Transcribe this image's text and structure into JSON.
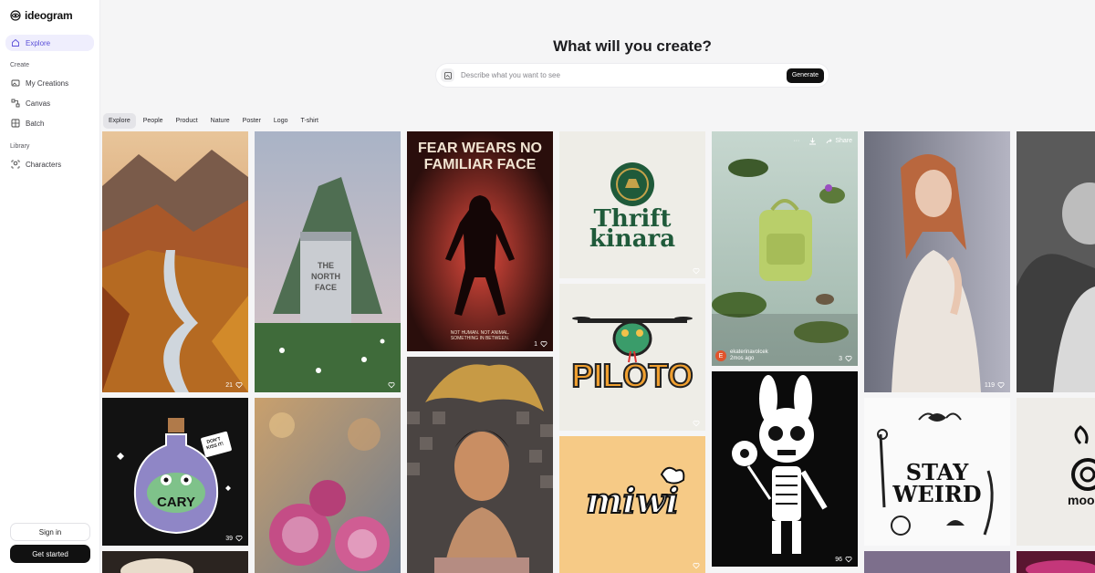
{
  "app": {
    "name": "ideogram"
  },
  "sidebar": {
    "explore": "Explore",
    "create_label": "Create",
    "create_items": [
      "My Creations",
      "Canvas",
      "Batch"
    ],
    "library_label": "Library",
    "library_items": [
      "Characters"
    ],
    "sign_in": "Sign in",
    "get_started": "Get started"
  },
  "header": {
    "title": "What will you create?",
    "search_placeholder": "Describe what you want to see",
    "generate": "Generate"
  },
  "tabs": [
    "Explore",
    "People",
    "Product",
    "Nature",
    "Poster",
    "Logo",
    "T-shirt"
  ],
  "active_tab": "Explore",
  "gallery": {
    "tiles": [
      {
        "likes": "21"
      },
      {
        "likes": ""
      },
      {
        "title_line1": "FEAR WEARS NO",
        "title_line2": "FAMILIAR FACE",
        "caption_line1": "NOT HUMAN. NOT ANIMAL.",
        "caption_line2": "SOMETHING IN BETWEEN.",
        "likes": "1"
      },
      {
        "word1": "Thrift",
        "word2": "kinara",
        "likes": ""
      },
      {
        "word": "PILOTO",
        "likes": ""
      },
      {
        "word": "miwi",
        "likes": ""
      },
      {
        "likes": "3",
        "author": "ekaterinavolcek",
        "time": "2mos ago",
        "avatar": "E",
        "share": "Share",
        "more": "···"
      },
      {
        "likes": "96"
      },
      {
        "likes": "119"
      },
      {
        "bottle_label": "CARY",
        "tag_line1": "DON'T",
        "tag_line2": "KISS IT!",
        "likes": "39"
      },
      {
        "line1": "STAY",
        "line2": "WEIRD"
      },
      {
        "word": "mooc"
      }
    ]
  },
  "colors": {
    "accent": "#5a4fd8",
    "nav_active_bg": "#efeefd",
    "dark_button": "#111111"
  }
}
